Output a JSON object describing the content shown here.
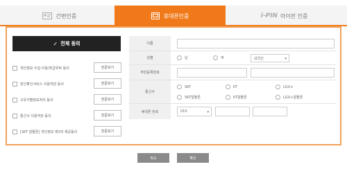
{
  "tabs": [
    {
      "label": "간편인증"
    },
    {
      "label": "휴대폰인증"
    },
    {
      "label": "아이핀 인증",
      "logo": "i-PIN"
    }
  ],
  "agreements": {
    "all_label": "전체 동의",
    "items": [
      {
        "label": "개인정보 수집·이용/취급위탁 동의",
        "button": "전문보기"
      },
      {
        "label": "본인확인서비스 이용약관 동의",
        "button": "전문보기"
      },
      {
        "label": "고유식별정보처리 동의",
        "button": "전문보기"
      },
      {
        "label": "통신사 이용약관 동의",
        "button": "전문보기"
      },
      {
        "label": "[SKT 알뜰폰] 개인정보 제3자 제공동의",
        "button": "전문보기"
      }
    ]
  },
  "form": {
    "name_label": "이름",
    "gender_label": "성별",
    "gender_male": "남",
    "gender_female": "여",
    "nationality_select": "내국인",
    "rrn_label": "주민등록번호",
    "carrier_label": "통신사",
    "carriers": [
      "SKT",
      "KT",
      "LGU+",
      "SKT알뜰폰",
      "KT알뜰폰",
      "LGU+알뜰폰"
    ],
    "phone_label": "휴대폰 번호",
    "phone_prefix": "010"
  },
  "buttons": {
    "cancel": "취소",
    "confirm": "확인"
  }
}
